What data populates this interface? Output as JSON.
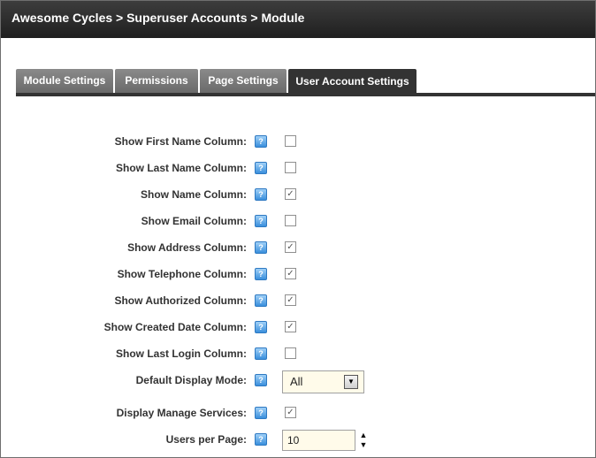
{
  "breadcrumb": "Awesome Cycles > Superuser Accounts > Module",
  "tabs": [
    {
      "label": "Module Settings"
    },
    {
      "label": "Permissions"
    },
    {
      "label": "Page Settings"
    },
    {
      "label": "User Account Settings"
    }
  ],
  "help_icon_glyph": "?",
  "fields": [
    {
      "label": "Show First Name Column:",
      "checked": false
    },
    {
      "label": "Show Last Name Column:",
      "checked": false
    },
    {
      "label": "Show Name Column:",
      "checked": true
    },
    {
      "label": "Show Email Column:",
      "checked": false
    },
    {
      "label": "Show Address Column:",
      "checked": true
    },
    {
      "label": "Show Telephone Column:",
      "checked": true
    },
    {
      "label": "Show Authorized Column:",
      "checked": true
    },
    {
      "label": "Show Created Date Column:",
      "checked": true
    },
    {
      "label": "Show Last Login Column:",
      "checked": false
    },
    {
      "label": "Default Display Mode:",
      "value": "All"
    },
    {
      "label": "Display Manage Services:",
      "checked": true
    },
    {
      "label": "Users per Page:",
      "value": "10"
    }
  ],
  "colors": {
    "titlebar": "#2b2b2b",
    "tab": "#7a7a7a",
    "active_tab": "#333333",
    "help_icon": "#3a8fdc",
    "input_bg": "#fffbea"
  }
}
